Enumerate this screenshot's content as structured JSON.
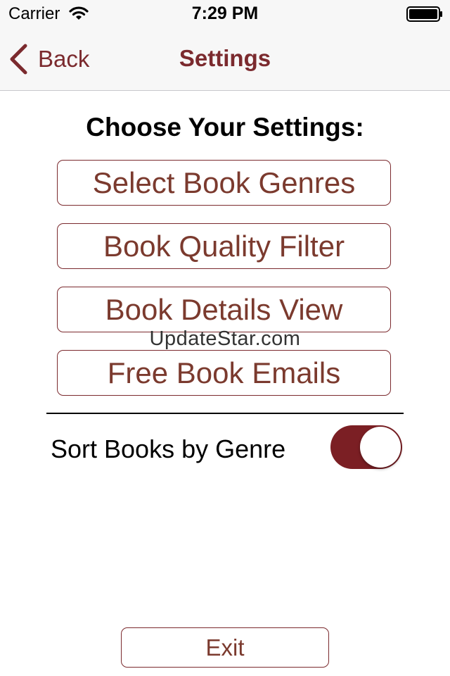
{
  "status_bar": {
    "carrier": "Carrier",
    "time": "7:29 PM"
  },
  "nav": {
    "back_label": "Back",
    "title": "Settings"
  },
  "content": {
    "heading": "Choose Your Settings:",
    "buttons": [
      {
        "label": "Select Book Genres"
      },
      {
        "label": "Book Quality Filter"
      },
      {
        "label": "Book Details View"
      },
      {
        "label": "Free Book Emails"
      }
    ],
    "watermark": "UpdateStar.com",
    "sort_toggle": {
      "label": "Sort Books by Genre",
      "on": true
    },
    "exit_label": "Exit"
  },
  "colors": {
    "accent": "#7b2a2e",
    "toggle_on": "#7b1f24",
    "nav_background": "#f7f7f7"
  },
  "icons": [
    "wifi-icon",
    "battery-icon",
    "back-chevron-icon"
  ]
}
